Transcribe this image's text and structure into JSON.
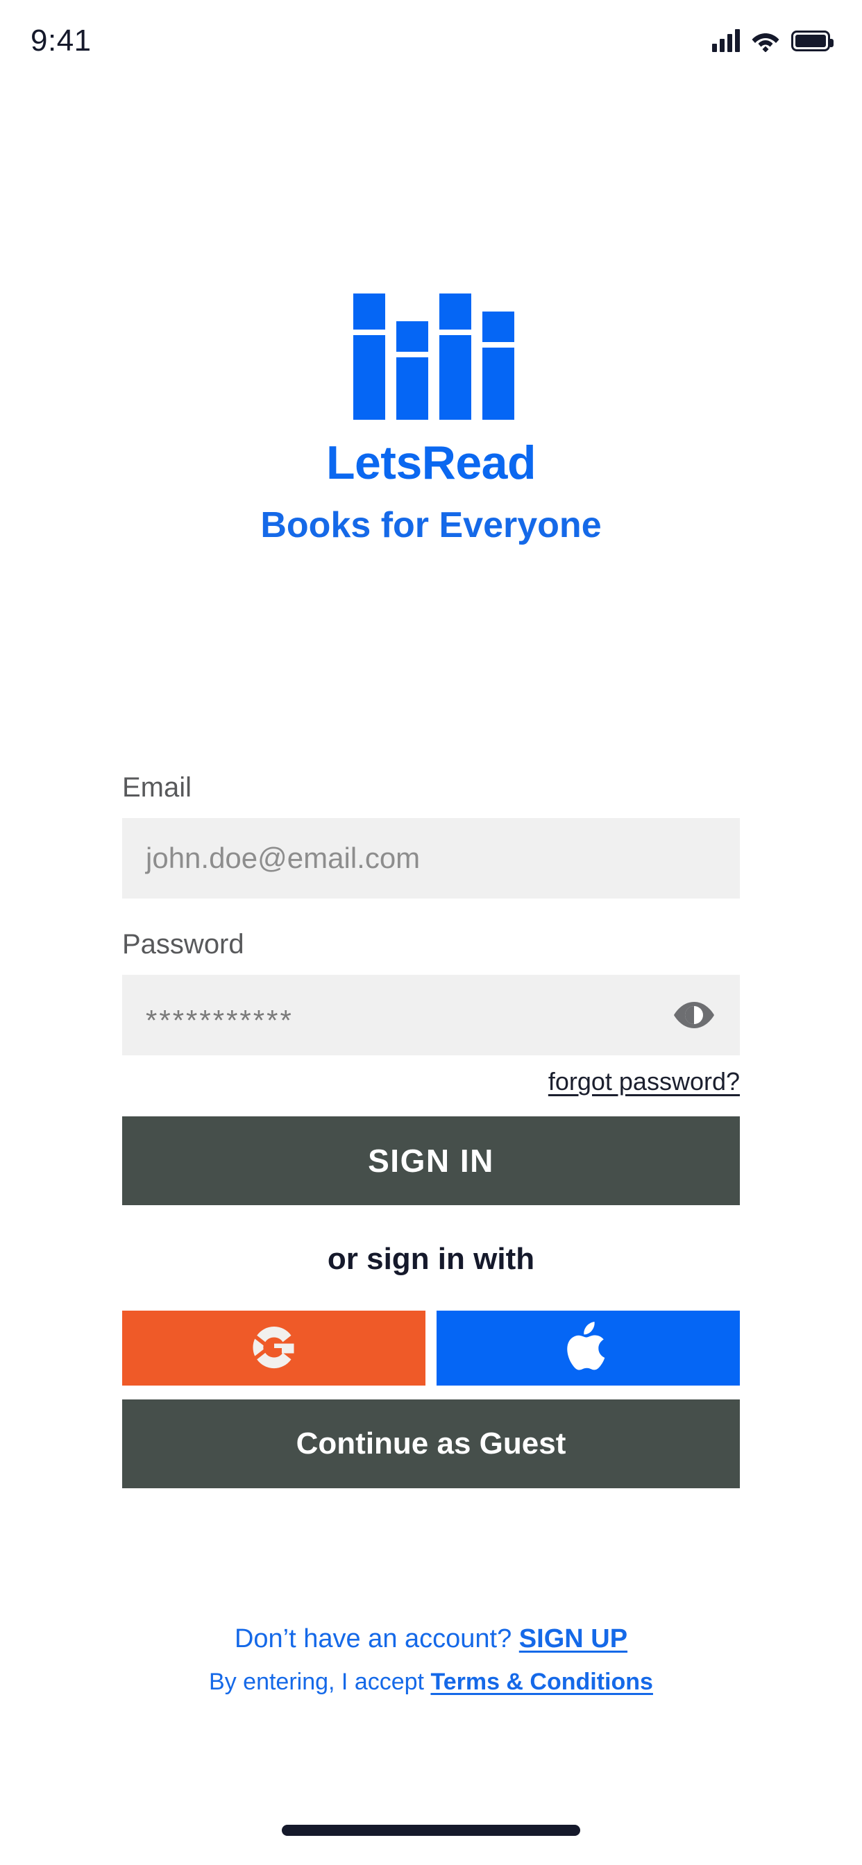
{
  "status_bar": {
    "time": "9:41",
    "signal_icon": "cellular-signal-icon",
    "wifi_icon": "wifi-icon",
    "battery_icon": "battery-full-icon"
  },
  "branding": {
    "logo_icon": "letsread-books-logo",
    "name": "LetsRead",
    "tagline": "Books for Everyone",
    "brand_color": "#0566f5",
    "name_color": "#0b68f0",
    "tagline_color": "#1569e8"
  },
  "form": {
    "email": {
      "label": "Email",
      "placeholder": "john.doe@email.com",
      "value": ""
    },
    "password": {
      "label": "Password",
      "value": "***********",
      "placeholder": "",
      "toggle_icon": "eye-icon"
    },
    "forgot_password_label": "forgot password?"
  },
  "actions": {
    "sign_in_label": "SIGN IN",
    "sign_in_color": "#464f4b",
    "divider_label": "or sign in with",
    "google_label": "",
    "google_icon": "google-g-icon",
    "google_color": "#ef5a28",
    "apple_label": "",
    "apple_icon": "apple-logo-icon",
    "apple_color": "#0566f5",
    "guest_label": "Continue as Guest",
    "guest_color": "#464f4b"
  },
  "footer": {
    "signup_prompt": "Don’t have an account?",
    "signup_link": "SIGN UP",
    "terms_prompt": "By entering, I accept",
    "terms_link": "Terms & Conditions",
    "link_color": "#1569e8"
  },
  "system": {
    "home_indicator": "home-indicator"
  }
}
